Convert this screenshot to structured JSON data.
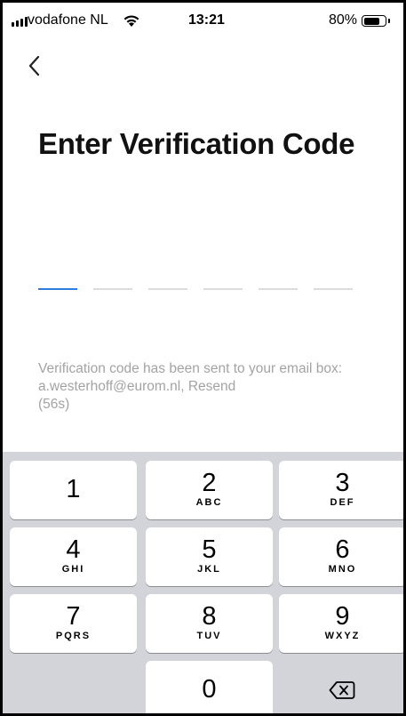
{
  "status_bar": {
    "carrier": "vodafone NL",
    "time": "13:21",
    "battery_percent": "80%",
    "battery_level": 0.8,
    "icons": [
      "signal-icon",
      "wifi-icon",
      "battery-icon"
    ]
  },
  "nav": {
    "back_icon": "chevron-left-icon"
  },
  "page": {
    "title": "Enter Verification Code",
    "code_length": 6,
    "active_slot": 0,
    "info_text": "Verification code has been sent to your email box: a.westerhoff@eurom.nl, ",
    "resend_label": "Resend",
    "resend_countdown": "(56s)"
  },
  "colors": {
    "accent": "#2f7de1",
    "info_text": "#a3a3a3",
    "keypad_bg": "#d2d4da"
  },
  "keypad": {
    "keys": [
      {
        "num": "1",
        "letters": ""
      },
      {
        "num": "2",
        "letters": "ABC"
      },
      {
        "num": "3",
        "letters": "DEF"
      },
      {
        "num": "4",
        "letters": "GHI"
      },
      {
        "num": "5",
        "letters": "JKL"
      },
      {
        "num": "6",
        "letters": "MNO"
      },
      {
        "num": "7",
        "letters": "PQRS"
      },
      {
        "num": "8",
        "letters": "TUV"
      },
      {
        "num": "9",
        "letters": "WXYZ"
      },
      {
        "num": "0",
        "letters": ""
      }
    ],
    "delete_icon": "backspace-icon"
  }
}
